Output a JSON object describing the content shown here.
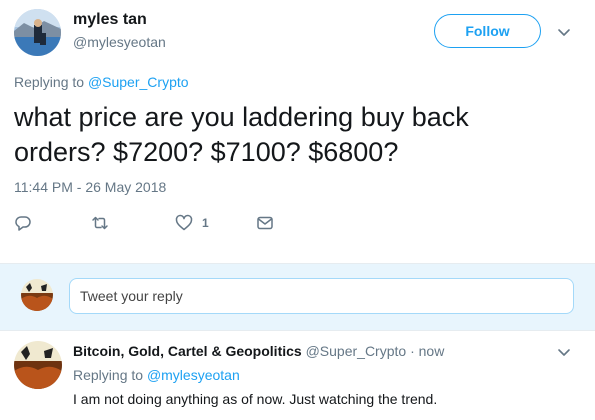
{
  "tweet": {
    "author_name": "myles tan",
    "author_handle": "@mylesyeotan",
    "follow_label": "Follow",
    "replying_prefix": "Replying to ",
    "replying_handle": "@Super_Crypto",
    "text_line1": "what price are you laddering buy back",
    "text_line2": "orders? $7200? $7100? $6800?",
    "timestamp": "11:44 PM - 26 May 2018",
    "like_count": "1",
    "icons": [
      "reply-icon",
      "retweet-icon",
      "heart-icon",
      "direct-message-icon",
      "chevron-down-icon"
    ]
  },
  "compose": {
    "placeholder": "Tweet your reply"
  },
  "reply": {
    "author_name": "Bitcoin, Gold, Cartel & Geopolitics",
    "author_handle": "@Super_Crypto",
    "time": "now",
    "separator": " · ",
    "replying_prefix": "Replying to ",
    "replying_handle": "@mylesyeotan",
    "text": "I am not doing anything as of now. Just watching the trend."
  },
  "colors": {
    "accent": "#1da1f2",
    "secondary_text": "#657786",
    "compose_bg": "#e8f5fd"
  }
}
